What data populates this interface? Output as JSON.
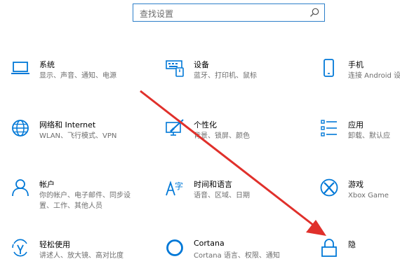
{
  "search": {
    "placeholder": "查找设置"
  },
  "tiles": [
    {
      "title": "系统",
      "desc": [
        "显示、声音、通知、电源"
      ]
    },
    {
      "title": "设备",
      "desc": [
        "蓝牙、打印机、鼠标"
      ]
    },
    {
      "title": "手机",
      "desc": [
        "连接 Android 设"
      ]
    },
    {
      "title": "网络和 Internet",
      "desc": [
        "WLAN、飞行模式、VPN"
      ]
    },
    {
      "title": "个性化",
      "desc": [
        "背景、锁屏、颜色"
      ]
    },
    {
      "title": "应用",
      "desc": [
        "卸载、默认应"
      ]
    },
    {
      "title": "帐户",
      "desc": [
        "你的帐户、电子邮件、同步设",
        "置、工作、其他人员"
      ]
    },
    {
      "title": "时间和语言",
      "desc": [
        "语音、区域、日期"
      ]
    },
    {
      "title": "游戏",
      "desc": [
        "Xbox Game"
      ]
    },
    {
      "title": "轻松使用",
      "desc": [
        "讲述人、放大镜、高对比度"
      ]
    },
    {
      "title": "Cortana",
      "desc": [
        "Cortana 语言、权限、通知"
      ]
    },
    {
      "title": "隐",
      "desc": [
        ""
      ]
    }
  ],
  "colors": {
    "accent": "#0078d7",
    "arrow": "#e0302b",
    "search_border": "#2d7fc9",
    "desc_text": "#6d6d6d"
  },
  "icons": [
    "search-icon",
    "laptop-icon",
    "keyboard-icon",
    "phone-icon",
    "globe-icon",
    "brush-icon",
    "apps-icon",
    "user-icon",
    "language-icon",
    "xbox-icon",
    "ease-of-access-icon",
    "cortana-icon",
    "lock-icon"
  ]
}
